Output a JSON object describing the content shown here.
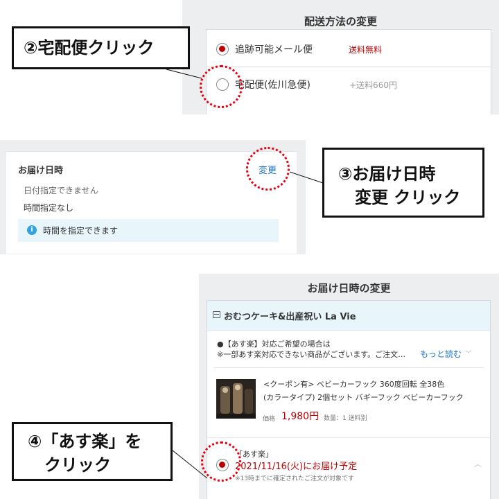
{
  "shipping": {
    "title": "配送方法の変更",
    "options": [
      {
        "label": "追跡可能メール便",
        "fee": "送料無料",
        "selected": true
      },
      {
        "label": "宅配便(佐川急便)",
        "fee": "+送料660円",
        "selected": false
      }
    ]
  },
  "delivery": {
    "heading": "お届け日時",
    "change_link": "変更",
    "date_note": "日付指定できません",
    "time_note": "時間指定なし",
    "info": "時間を指定できます"
  },
  "change_delivery": {
    "title": "お届け日時の変更",
    "shop_name": "おむつケーキ&出産祝い La Vie",
    "notice_line1": "●【あす楽】対応ご希望の場合は",
    "notice_line2": "※一部あす楽対応できない商品がございます。ご注文前に商品ページをご確認ください。",
    "read_more": "もっと読む",
    "product_line1": "<クーポン有> ベビーカーフック 360度回転 全38色",
    "product_line2": "(カラータイプ) 2個セット バギーフック ベビーカーフック",
    "price_label": "価格",
    "price": "1,980円",
    "qty": "数量：1 送料別",
    "option_label": "「あす楽」",
    "option_date": "2021/11/16(火)にお届け予定",
    "option_note": "※13時までに確定されたご注文が対象です"
  },
  "callouts": {
    "step2": "②宅配便クリック",
    "step3_line1": "③お届け日時",
    "step3_line2": "変更 クリック",
    "step4_line1": "④「あす楽」を",
    "step4_line2": "クリック"
  },
  "colors": {
    "accent_red": "#bf0000",
    "link_blue": "#1a73c8",
    "highlight_red": "#e60012",
    "info_bg": "#e8f5fb"
  }
}
